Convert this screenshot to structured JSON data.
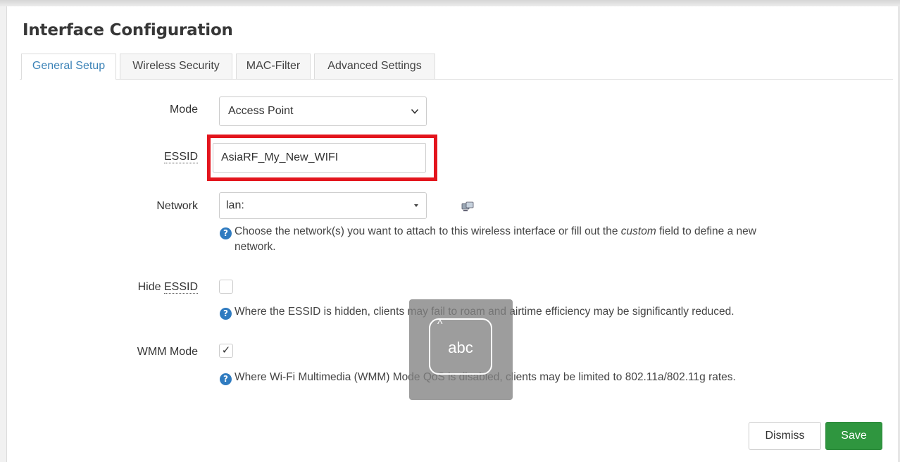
{
  "title": "Interface Configuration",
  "tabs": [
    {
      "label": "General Setup",
      "active": true
    },
    {
      "label": "Wireless Security",
      "active": false
    },
    {
      "label": "MAC-Filter",
      "active": false
    },
    {
      "label": "Advanced Settings",
      "active": false
    }
  ],
  "form": {
    "mode": {
      "label": "Mode",
      "value": "Access Point"
    },
    "essid": {
      "label": "ESSID",
      "value": "AsiaRF_My_New_WIFI"
    },
    "network": {
      "label": "Network",
      "value": "lan:",
      "help_before": "Choose the network(s) you want to attach to this wireless interface or fill out the",
      "help_em": "custom",
      "help_after": "field to define a new",
      "help_line2": "network."
    },
    "hide_essid": {
      "label_prefix": "Hide ",
      "label_abbr": "ESSID",
      "checked": false,
      "help": "Where the ESSID is hidden, clients may fail to roam and airtime efficiency may be significantly reduced."
    },
    "wmm_mode": {
      "label": "WMM Mode",
      "checked": true,
      "check_glyph": "✓",
      "help": "Where Wi-Fi Multimedia (WMM) Mode QoS is disabled, clients may be limited to 802.11a/802.11g rates."
    }
  },
  "help_glyph": "?",
  "keyboard_overlay": {
    "text": "abc",
    "caret": "^"
  },
  "buttons": {
    "dismiss": "Dismiss",
    "save": "Save"
  },
  "colors": {
    "accent": "#3c83b7",
    "highlight": "#e3151d",
    "save": "#2f963f",
    "help_icon": "#2f7bc0"
  }
}
